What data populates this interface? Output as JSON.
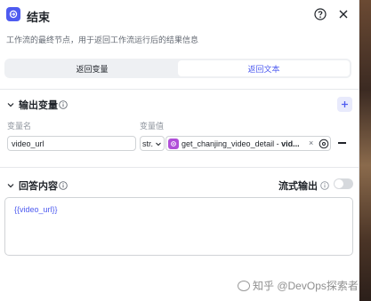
{
  "header": {
    "title": "结束",
    "description": "工作流的最终节点，用于返回工作流运行后的结果信息"
  },
  "tabs": [
    {
      "label": "返回变量",
      "active": false
    },
    {
      "label": "返回文本",
      "active": true
    }
  ],
  "output_section": {
    "title": "输出变量",
    "col_name_label": "变量名",
    "col_value_label": "变量值",
    "row": {
      "name_value": "video_url",
      "type_value": "str.",
      "ref_prefix": "get_chanjing_video_detail - ",
      "ref_field": "vid...",
      "clear_glyph": "×"
    }
  },
  "answer_section": {
    "title": "回答内容",
    "stream_label": "流式输出",
    "stream_enabled": false,
    "content": "{{video_url}}"
  },
  "watermark": "知乎 @DevOps探索者",
  "colors": {
    "accent": "#4e5bf0",
    "plugin": "#b04ed8",
    "background": "#ffffff"
  }
}
